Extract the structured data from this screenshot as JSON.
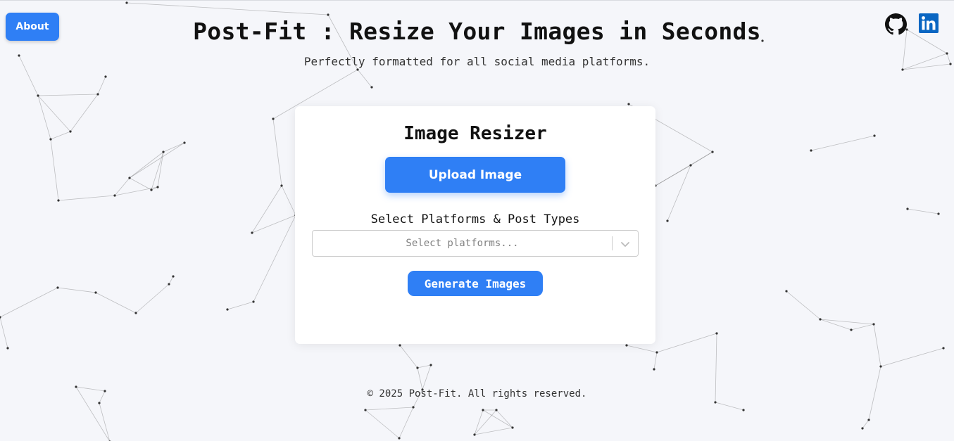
{
  "header": {
    "about_label": "About",
    "title": "Post-Fit : Resize Your Images in Seconds",
    "subtitle": "Perfectly formatted for all social media platforms.",
    "social": [
      {
        "icon": "github-icon"
      },
      {
        "icon": "linkedin-icon"
      }
    ]
  },
  "card": {
    "title": "Image Resizer",
    "upload_label": "Upload Image",
    "select_label": "Select Platforms & Post Types",
    "select_placeholder": "Select platforms...",
    "generate_label": "Generate Images"
  },
  "footer": {
    "text": "© 2025 Post-Fit. All rights reserved."
  },
  "colors": {
    "accent": "#2f7ff5",
    "background": "#f5f6fa",
    "linkedin": "#0a66c2"
  }
}
